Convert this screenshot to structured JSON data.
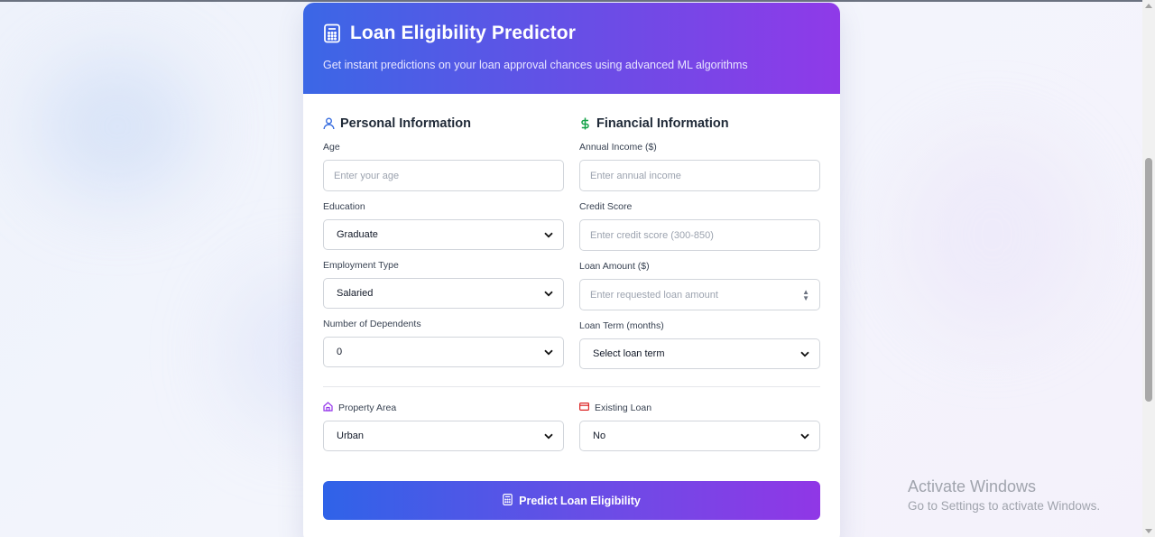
{
  "header": {
    "title": "Loan Eligibility Predictor",
    "subtitle": "Get instant predictions on your loan approval chances using advanced ML algorithms",
    "icon": "calculator-icon"
  },
  "personal": {
    "title": "Personal Information",
    "icon": "user-icon",
    "age": {
      "label": "Age",
      "placeholder": "Enter your age"
    },
    "education": {
      "label": "Education",
      "value": "Graduate"
    },
    "employment": {
      "label": "Employment Type",
      "value": "Salaried"
    },
    "dependents": {
      "label": "Number of Dependents",
      "value": "0"
    }
  },
  "financial": {
    "title": "Financial Information",
    "icon": "dollar-icon",
    "income": {
      "label": "Annual Income ($)",
      "placeholder": "Enter annual income"
    },
    "credit": {
      "label": "Credit Score",
      "placeholder": "Enter credit score (300-850)"
    },
    "loan_amount": {
      "label": "Loan Amount ($)",
      "placeholder": "Enter requested loan amount"
    },
    "loan_term": {
      "label": "Loan Term (months)",
      "value": "Select loan term"
    }
  },
  "extra": {
    "property": {
      "label": "Property Area",
      "value": "Urban",
      "icon": "home-icon"
    },
    "existing": {
      "label": "Existing Loan",
      "value": "No",
      "icon": "credit-card-icon"
    }
  },
  "predict_button": {
    "label": "Predict Loan Eligibility",
    "icon": "calculator-icon"
  },
  "watermark": {
    "line1": "Activate Windows",
    "line2": "Go to Settings to activate Windows."
  },
  "colors": {
    "gradient_start": "#3b67e6",
    "gradient_end": "#8f3ae8",
    "user_icon": "#3b6fe0",
    "dollar_icon": "#16a34a",
    "home_icon": "#9333ea",
    "card_icon": "#dc2626"
  }
}
